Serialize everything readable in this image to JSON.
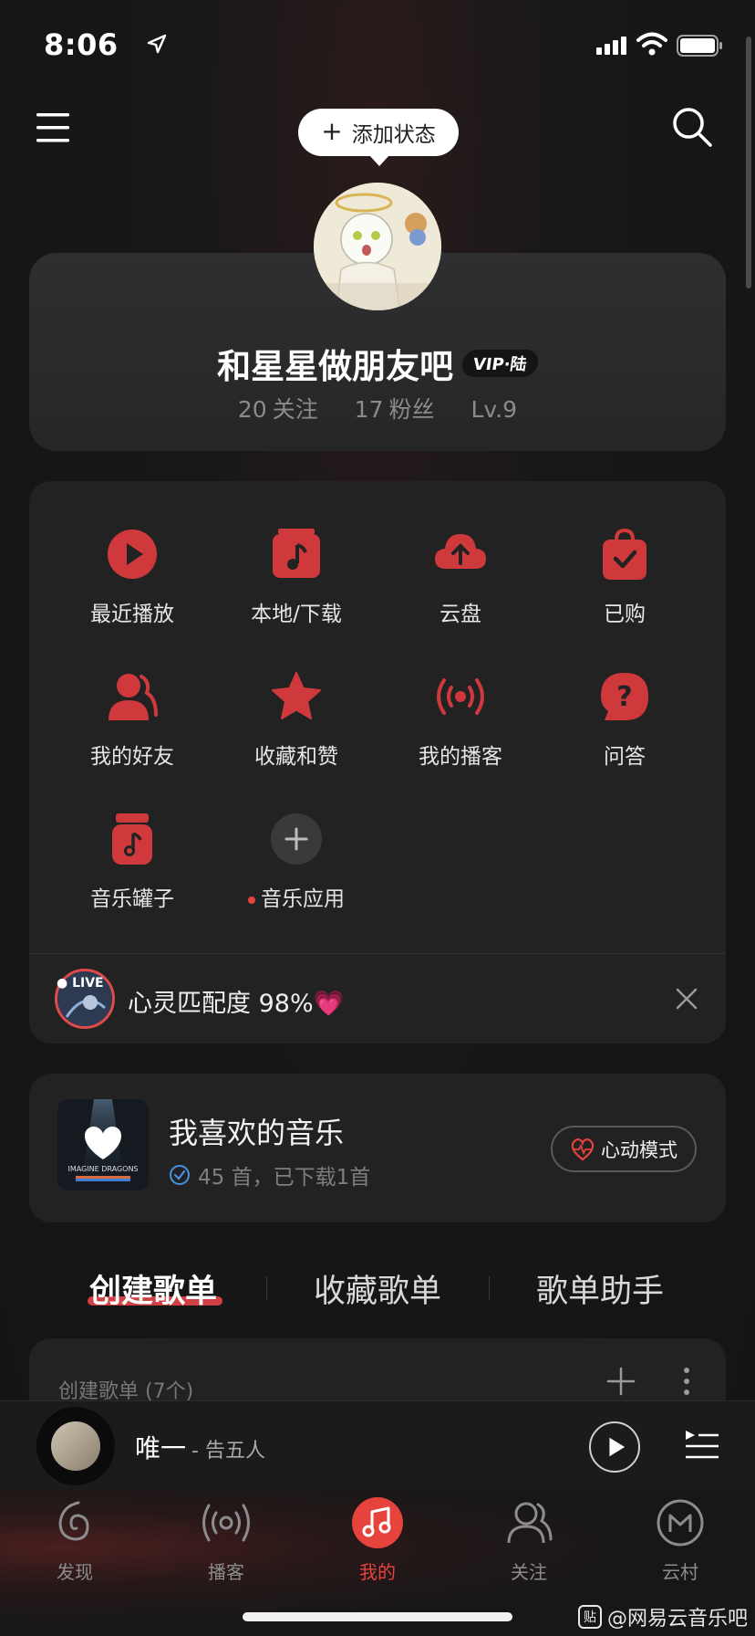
{
  "status_bar": {
    "time": "8:06"
  },
  "profile": {
    "status_button": "添加状态",
    "username": "和星星做朋友吧",
    "vip_badge": "VIP·陆",
    "following_count": "20",
    "following_label": "关注",
    "followers_count": "17",
    "followers_label": "粉丝",
    "level": "Lv.9"
  },
  "shortcuts": [
    {
      "label": "最近播放",
      "icon": "play-circle-icon"
    },
    {
      "label": "本地/下载",
      "icon": "music-folder-icon"
    },
    {
      "label": "云盘",
      "icon": "cloud-upload-icon"
    },
    {
      "label": "已购",
      "icon": "shopping-bag-icon"
    },
    {
      "label": "我的好友",
      "icon": "friends-icon"
    },
    {
      "label": "收藏和赞",
      "icon": "star-icon"
    },
    {
      "label": "我的播客",
      "icon": "broadcast-icon"
    },
    {
      "label": "问答",
      "icon": "question-bubble-icon"
    },
    {
      "label": "音乐罐子",
      "icon": "music-jar-icon"
    },
    {
      "label": "音乐应用",
      "icon": "add-circle-icon"
    }
  ],
  "match_banner": {
    "live_tag": "LIVE",
    "text": "心灵匹配度 98%💗"
  },
  "favorites": {
    "title": "我喜欢的音乐",
    "subtitle": "45 首，已下载1首",
    "cover_text": "IMAGINE DRAGONS",
    "heart_mode_label": "心动模式"
  },
  "tabs": [
    {
      "label": "创建歌单",
      "active": true
    },
    {
      "label": "收藏歌单",
      "active": false
    },
    {
      "label": "歌单助手",
      "active": false
    }
  ],
  "playlist_section": {
    "header": "创建歌单 (7个)"
  },
  "mini_player": {
    "title": "唯一",
    "artist": "- 告五人"
  },
  "bottom_nav": [
    {
      "label": "发现",
      "icon": "discover-icon",
      "active": false
    },
    {
      "label": "播客",
      "icon": "podcast-icon",
      "active": false
    },
    {
      "label": "我的",
      "icon": "my-music-icon",
      "active": true
    },
    {
      "label": "关注",
      "icon": "follow-icon",
      "active": false
    },
    {
      "label": "云村",
      "icon": "village-icon",
      "active": false
    }
  ],
  "watermark": {
    "badge": "贴",
    "text": "@网易云音乐吧"
  },
  "colors": {
    "accent": "#e7433d",
    "background": "#141415",
    "card": "#222223"
  }
}
